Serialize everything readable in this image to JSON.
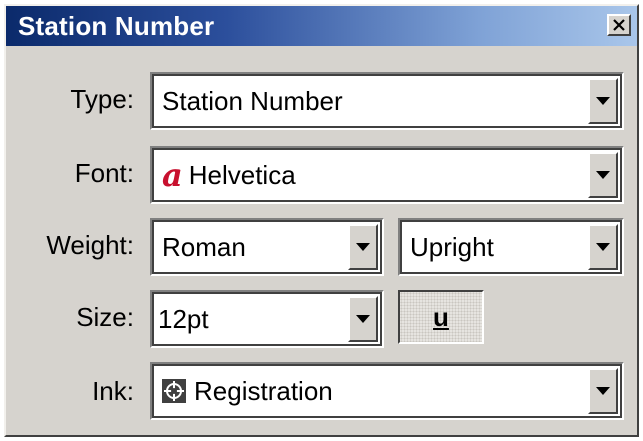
{
  "window": {
    "title": "Station Number",
    "close_icon": "close-icon"
  },
  "form": {
    "type": {
      "label": "Type:",
      "value": "Station Number"
    },
    "font": {
      "label": "Font:",
      "value": "Helvetica",
      "icon": "font-icon",
      "icon_glyph": "a",
      "icon_color": "#c8102e"
    },
    "weight": {
      "label": "Weight:",
      "value": "Roman",
      "style_value": "Upright"
    },
    "size": {
      "label": "Size:",
      "value": "12pt",
      "underline_label": "u"
    },
    "ink": {
      "label": "Ink:",
      "value": "Registration",
      "icon": "registration-mark-icon"
    }
  },
  "colors": {
    "titlebar_start": "#0b2a6b",
    "titlebar_end": "#a9c6ea",
    "dialog_bg": "#d6d3ce"
  }
}
